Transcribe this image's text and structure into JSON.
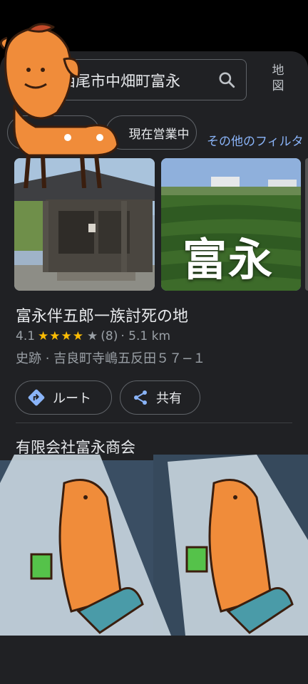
{
  "search": {
    "query": "西尾市中畑町富永"
  },
  "header": {
    "map_label_line1": "地",
    "map_label_line2": "図"
  },
  "filters": {
    "open_now": "現在営業中",
    "more": "その他のフィルタ"
  },
  "photos": {
    "overlay_text": "富永"
  },
  "place": {
    "title": "富永伴五郎一族討死の地",
    "rating": "4.1",
    "stars_full": "★★★★",
    "stars_empty": "★",
    "review_count": "(8)",
    "distance": "· 5.1 km",
    "category_address": "史跡 · 吉良町寺嶋五反田５７−１"
  },
  "actions": {
    "route": "ルート",
    "share": "共有"
  },
  "next_place": {
    "title": "有限会社富永商会"
  },
  "colors": {
    "background": "#202124",
    "accent_blue": "#8ab4f8",
    "star": "#fbbc04",
    "deer": "#f08c3a"
  }
}
